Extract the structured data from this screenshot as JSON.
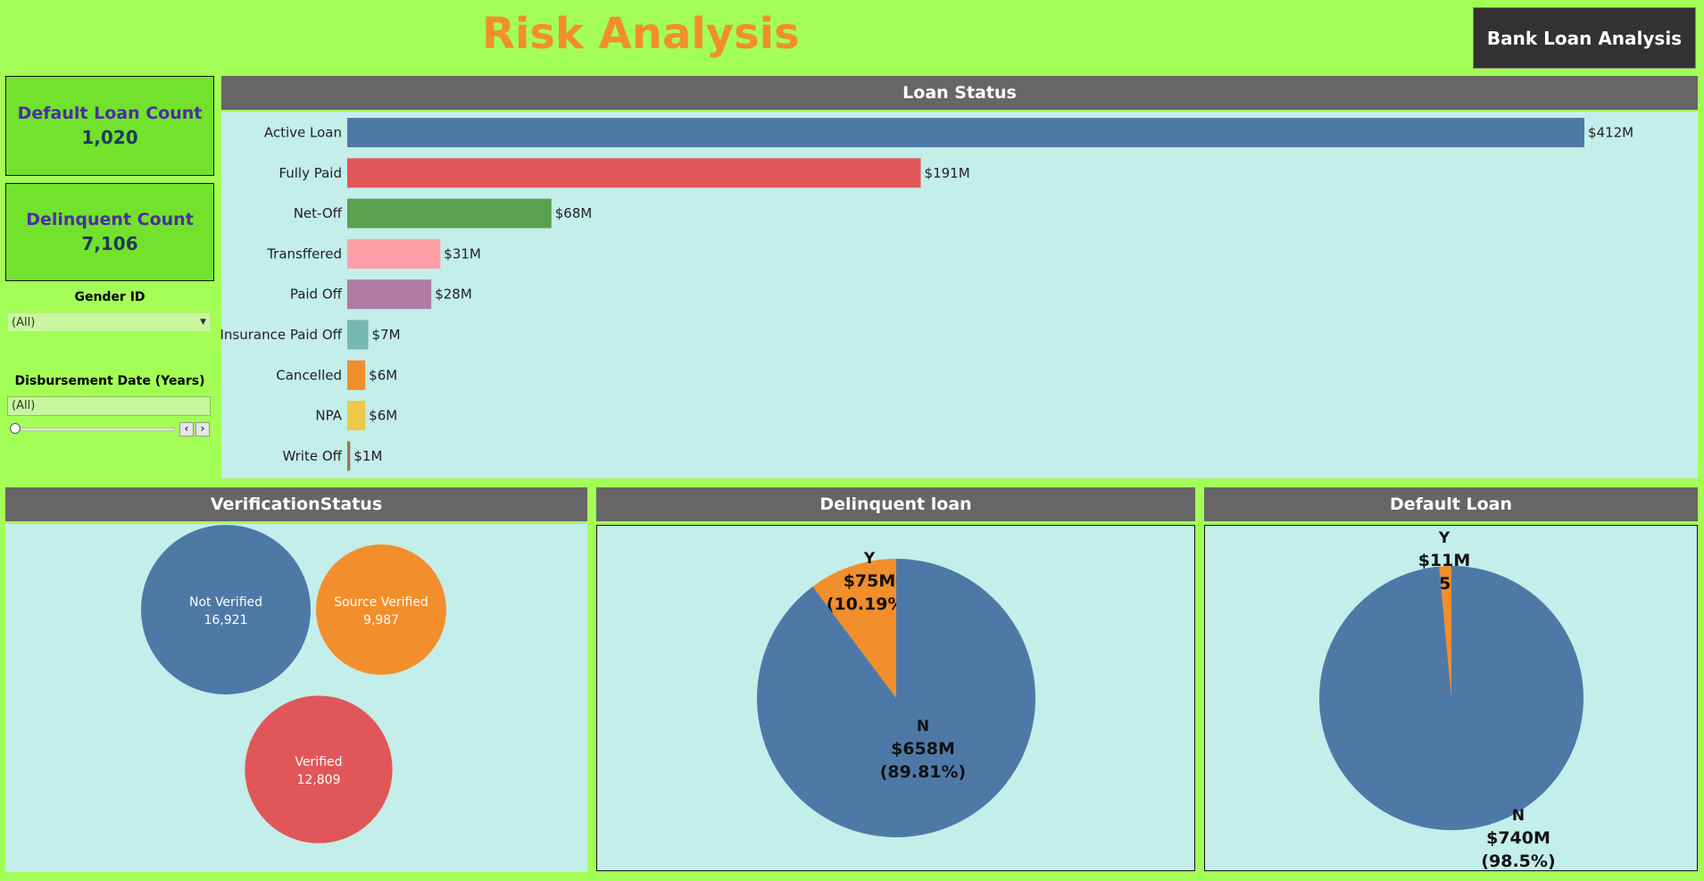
{
  "header": {
    "title": "Risk Analysis",
    "nav_button": "Bank Loan Analysis"
  },
  "kpis": [
    {
      "label": "Default Loan Count",
      "value": "1,020"
    },
    {
      "label": "Delinquent Count",
      "value": "7,106"
    }
  ],
  "filters": {
    "gender": {
      "label": "Gender ID",
      "value": "(All)"
    },
    "date": {
      "label": "Disbursement Date (Years)",
      "value": "(All)"
    }
  },
  "panels": {
    "loan_status": "Loan Status",
    "verification": "VerificationStatus",
    "delinquent": "Delinquent loan",
    "default": "Default Loan"
  },
  "colors": {
    "blue": "#4e79a7",
    "red": "#e15759",
    "green": "#59a14f",
    "pink": "#ff9da7",
    "purple": "#b07aa1",
    "teal": "#76b7b2",
    "orange": "#f28e2b",
    "yellow": "#edc948",
    "brown": "#9c755f"
  },
  "chart_data": [
    {
      "type": "bar",
      "orientation": "horizontal",
      "title": "Loan Status",
      "categories": [
        "Active Loan",
        "Fully Paid",
        "Net-Off",
        "Transffered",
        "Paid Off",
        "Insurance Paid Off",
        "Cancelled",
        "NPA",
        "Write Off"
      ],
      "values": [
        412,
        191,
        68,
        31,
        28,
        7,
        6,
        6,
        1
      ],
      "labels": [
        "$412M",
        "$191M",
        "$68M",
        "$31M",
        "$28M",
        "$7M",
        "$6M",
        "$6M",
        "$1M"
      ],
      "unit": "$M",
      "colors": [
        "#4e79a7",
        "#e15759",
        "#59a14f",
        "#ff9da7",
        "#b07aa1",
        "#76b7b2",
        "#f28e2b",
        "#edc948",
        "#9c755f"
      ]
    },
    {
      "type": "bubble",
      "title": "VerificationStatus",
      "items": [
        {
          "name": "Not Verified",
          "value": 16921,
          "label": "16,921",
          "color": "#4e79a7"
        },
        {
          "name": "Source Verified",
          "value": 9987,
          "label": "9,987",
          "color": "#f28e2b"
        },
        {
          "name": "Verified",
          "value": 12809,
          "label": "12,809",
          "color": "#e15759"
        }
      ]
    },
    {
      "type": "pie",
      "title": "Delinquent loan",
      "slices": [
        {
          "name": "Y",
          "value": 75,
          "amount": "$75M",
          "pct": "(10.19%)",
          "color": "#f28e2b"
        },
        {
          "name": "N",
          "value": 658,
          "amount": "$658M",
          "pct": "(89.81%)",
          "color": "#4e79a7"
        }
      ]
    },
    {
      "type": "pie",
      "title": "Default Loan",
      "slices": [
        {
          "name": "Y",
          "value": 11,
          "amount": "$11M",
          "pct": "(1.5%)",
          "color": "#f28e2b"
        },
        {
          "name": "N",
          "value": 740,
          "amount": "$740M",
          "pct": "(98.5%)",
          "color": "#4e79a7"
        }
      ]
    }
  ]
}
